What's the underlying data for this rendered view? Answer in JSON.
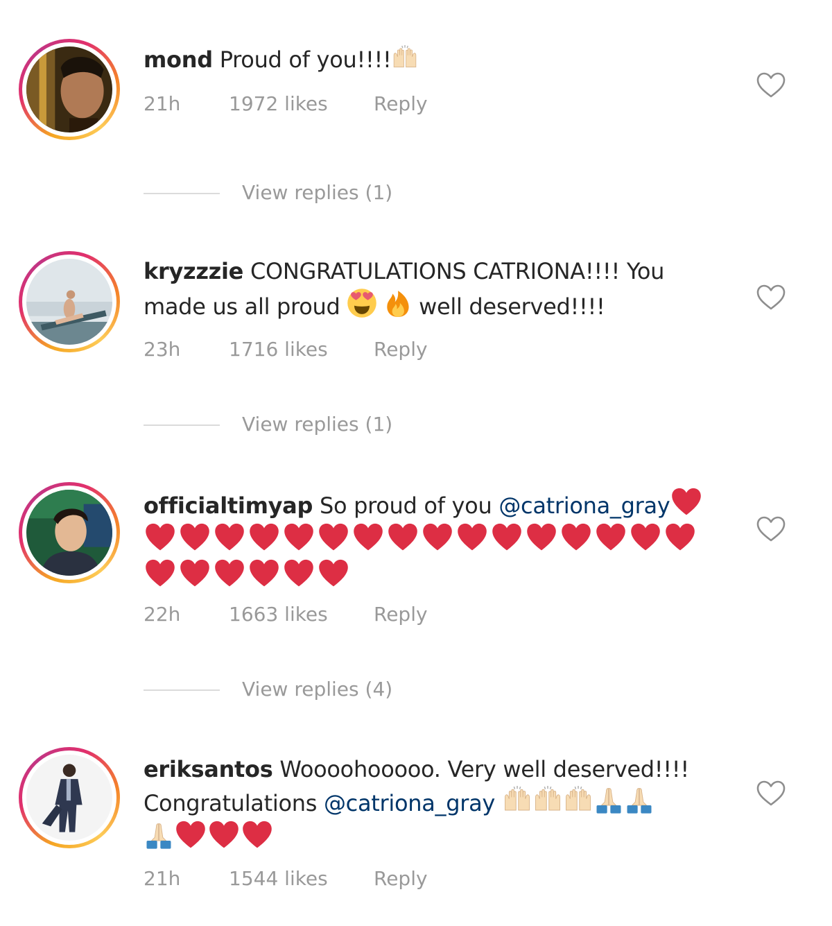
{
  "comments": [
    {
      "username": "mond",
      "text": "Proud of you!!!!",
      "time": "21h",
      "likes": "1972 likes",
      "reply_label": "Reply",
      "view_replies": "View replies (1)"
    },
    {
      "username": "kryzzzie",
      "text_part1": "CONGRATULATIONS CATRIONA!!!! You made us all proud",
      "text_part2": "well deserved!!!!",
      "time": "23h",
      "likes": "1716 likes",
      "reply_label": "Reply",
      "view_replies": "View replies (1)"
    },
    {
      "username": "officialtimyap",
      "text": "So proud of you",
      "mention": "@catriona_gray",
      "heart_count": 22,
      "time": "22h",
      "likes": "1663 likes",
      "reply_label": "Reply",
      "view_replies": "View replies (4)"
    },
    {
      "username": "eriksantos",
      "text": "Woooohooooo. Very well deserved!!!! Congratulations",
      "mention": "@catriona_gray",
      "time": "21h",
      "likes": "1544 likes",
      "reply_label": "Reply"
    }
  ],
  "icons": {
    "like": "heart-outline-icon",
    "heart_emoji": "red-heart-emoji",
    "raising_hands": "raising-hands-emoji",
    "praying_hands": "folded-hands-emoji",
    "heart_eyes": "heart-eyes-emoji",
    "fire": "fire-emoji"
  },
  "colors": {
    "text": "#262626",
    "meta": "#999999",
    "mention": "#003569",
    "heart_emoji": "#dd2e44",
    "divider": "#dbdbdb"
  }
}
